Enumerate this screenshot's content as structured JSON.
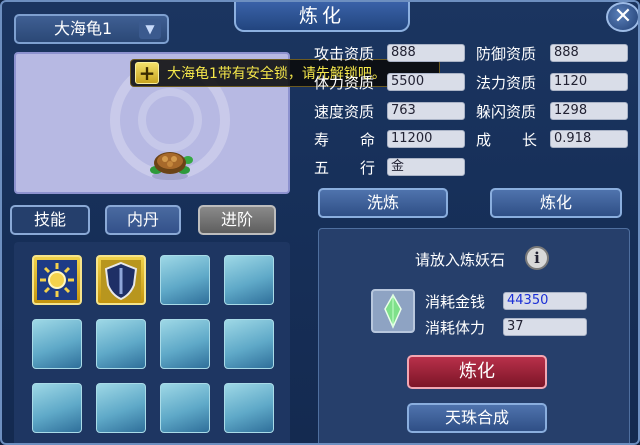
{
  "window": {
    "title": "炼化",
    "close_glyph": "✕"
  },
  "pet_selector": {
    "name": "大海龟1",
    "chevron": "▼"
  },
  "tooltip": {
    "plus": "+",
    "message": "大海龟1带有安全锁，请先解锁吧。"
  },
  "tabs": {
    "skill": "技能",
    "core": "内丹",
    "advance": "进阶"
  },
  "stats": {
    "attack": {
      "label": "攻击资质",
      "value": "888"
    },
    "defense": {
      "label": "防御资质",
      "value": "888"
    },
    "stamina": {
      "label": "体力资质",
      "value": "5500"
    },
    "magic": {
      "label": "法力资质",
      "value": "1120"
    },
    "speed": {
      "label": "速度资质",
      "value": "763"
    },
    "dodge": {
      "label": "躲闪资质",
      "value": "1298"
    },
    "life": {
      "label": "寿　命",
      "value": "11200"
    },
    "growth": {
      "label": "成　长",
      "value": "0.918"
    },
    "element": {
      "label": "五　行",
      "value": "金"
    }
  },
  "actions": {
    "wash": "洗炼",
    "refine_tab": "炼化"
  },
  "refine": {
    "prompt": "请放入炼妖石",
    "info": "i",
    "cost_money_label": "消耗金钱",
    "cost_money_value": "44350",
    "cost_stamina_label": "消耗体力",
    "cost_stamina_value": "37",
    "refine_button": "炼化",
    "pearl_button": "天珠合成"
  },
  "colors": {
    "tooltip_text": "#f4e64a",
    "money_text": "#1b2fd6",
    "refine_button": "#9a2238"
  }
}
